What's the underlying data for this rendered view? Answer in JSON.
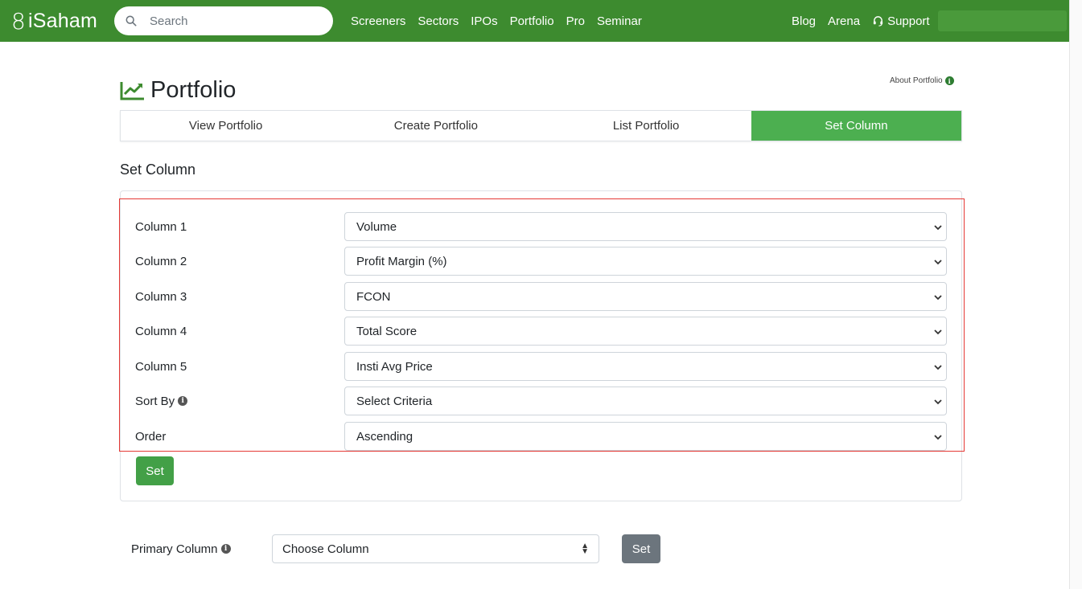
{
  "navbar": {
    "brand": "iSaham",
    "search_placeholder": "Search",
    "links": [
      "Screeners",
      "Sectors",
      "IPOs",
      "Portfolio",
      "Pro",
      "Seminar"
    ],
    "right_links": [
      "Blog",
      "Arena"
    ],
    "support_label": "Support",
    "bg_color": "#3d8b2f"
  },
  "page": {
    "title": "Portfolio",
    "about_label": "About Portfolio",
    "tabs": [
      {
        "label": "View Portfolio",
        "active": false
      },
      {
        "label": "Create Portfolio",
        "active": false
      },
      {
        "label": "List Portfolio",
        "active": false
      },
      {
        "label": "Set Column",
        "active": true
      }
    ],
    "section_title": "Set Column"
  },
  "form": {
    "rows": [
      {
        "label": "Column 1",
        "value": "Volume"
      },
      {
        "label": "Column 2",
        "value": "Profit Margin (%)"
      },
      {
        "label": "Column 3",
        "value": "FCON"
      },
      {
        "label": "Column 4",
        "value": "Total Score"
      },
      {
        "label": "Column 5",
        "value": "Insti Avg Price"
      },
      {
        "label": "Sort By",
        "value": "Select Criteria",
        "info": true
      },
      {
        "label": "Order",
        "value": "Ascending"
      }
    ],
    "set_label": "Set"
  },
  "primary": {
    "label": "Primary Column",
    "value": "Choose Column",
    "set_label": "Set"
  },
  "colors": {
    "accent": "#4caf50",
    "highlight": "#e53935",
    "grey_button": "#6c757d"
  }
}
